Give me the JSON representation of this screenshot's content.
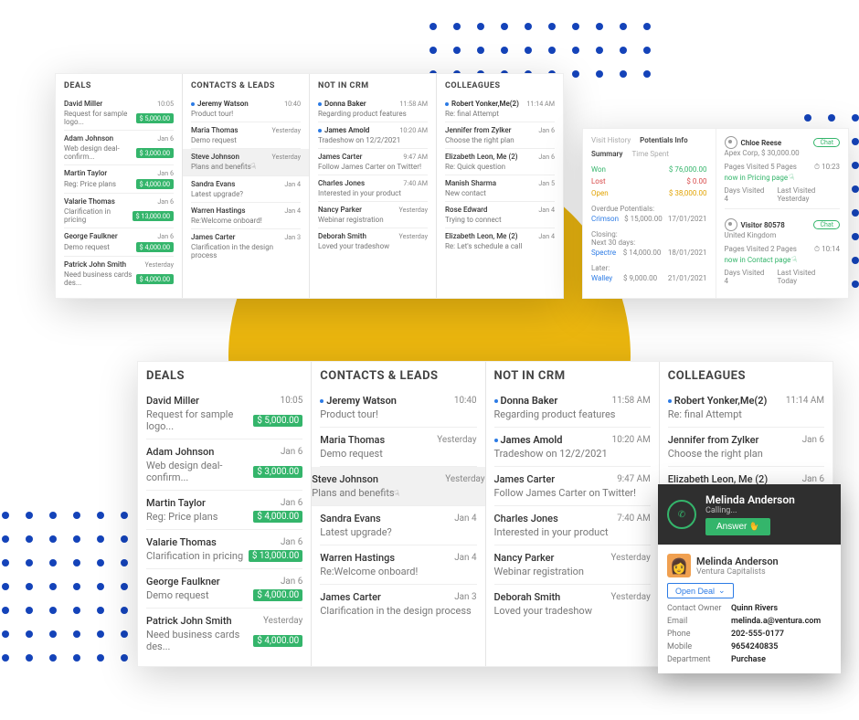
{
  "columns": [
    "DEALS",
    "CONTACTS & LEADS",
    "NOT IN CRM",
    "COLLEAGUES"
  ],
  "small": {
    "deals": [
      {
        "name": "David Miller",
        "time": "10:05",
        "sub": "Request for sample logo...",
        "badge": "$ 5,000.00"
      },
      {
        "name": "Adam Johnson",
        "time": "Jan 6",
        "sub": "Web design deal-confirm...",
        "badge": "$ 3,000.00"
      },
      {
        "name": "Martin Taylor",
        "time": "Jan 6",
        "sub": "Reg: Price plans",
        "badge": "$ 4,000.00"
      },
      {
        "name": "Valarie Thomas",
        "time": "Jan 6",
        "sub": "Clarification in pricing",
        "badge": "$ 13,000.00"
      },
      {
        "name": "George Faulkner",
        "time": "Jan 6",
        "sub": "Demo request",
        "badge": "$ 4,000.00"
      },
      {
        "name": "Patrick John Smith",
        "time": "Yesterday",
        "sub": "Need business cards des...",
        "badge": "$ 4,000.00"
      }
    ],
    "contacts": [
      {
        "name": "Jeremy Watson",
        "time": "10:40",
        "sub": "Product tour!",
        "dot": true
      },
      {
        "name": "Maria Thomas",
        "time": "Yesterday",
        "sub": "Demo request"
      },
      {
        "name": "Steve Johnson",
        "time": "Yesterday",
        "sub": "Plans and benefits",
        "sel": true,
        "cursor": true
      },
      {
        "name": "Sandra Evans",
        "time": "Jan 4",
        "sub": "Latest upgrade?"
      },
      {
        "name": "Warren Hastings",
        "time": "Jan 4",
        "sub": "Re:Welcome onboard!"
      },
      {
        "name": "James Carter",
        "time": "Jan 3",
        "sub": "Clarification in the design process"
      }
    ],
    "notcrm": [
      {
        "name": "Donna Baker",
        "time": "11:58 AM",
        "sub": "Regarding product features",
        "dot": true
      },
      {
        "name": "James Amold",
        "time": "10:20 AM",
        "sub": "Tradeshow on 12/2/2021",
        "dot": true
      },
      {
        "name": "James Carter",
        "time": "9:47 AM",
        "sub": "Follow James Carter on Twitter!"
      },
      {
        "name": "Charles Jones",
        "time": "7:40 AM",
        "sub": "Interested in your product"
      },
      {
        "name": "Nancy Parker",
        "time": "Yesterday",
        "sub": "Webinar registration"
      },
      {
        "name": "Deborah Smith",
        "time": "Yesterday",
        "sub": "Loved your tradeshow"
      }
    ],
    "colleagues": [
      {
        "name": "Robert Yonker,Me(2)",
        "time": "11:14 AM",
        "sub": "Re: final Attempt",
        "dot": true
      },
      {
        "name": "Jennifer from Zylker",
        "time": "Jan 6",
        "sub": "Choose the right plan"
      },
      {
        "name": "Elizabeth Leon, Me (2)",
        "time": "Jan 6",
        "sub": "Re: Quick question"
      },
      {
        "name": "Manish Sharma",
        "time": "Jan 5",
        "sub": "New contact"
      },
      {
        "name": "Rose Edward",
        "time": "Jan 4",
        "sub": "Trying to connect"
      },
      {
        "name": "Elizabeth Leon, Me (2)",
        "time": "Jan 4",
        "sub": "Re: Let's schedule a call"
      }
    ]
  },
  "analytics": {
    "tabs": [
      "Visit History",
      "Potentials Info"
    ],
    "subtabs": [
      "Summary",
      "Time Spent"
    ],
    "summary": [
      {
        "label": "Won",
        "value": "$ 76,000.00",
        "cls": "win"
      },
      {
        "label": "Lost",
        "value": "$ 0.00",
        "cls": "lost"
      },
      {
        "label": "Open",
        "value": "$ 38,000.00",
        "cls": "open"
      }
    ],
    "overdue_title": "Overdue Potentials:",
    "overdue": [
      {
        "name": "Crimson",
        "amt": "$ 15,000.00",
        "date": "17/01/2021"
      }
    ],
    "closing_title": "Closing:",
    "closing_sub": "Next 30 days:",
    "closing": [
      {
        "name": "Spectre",
        "amt": "$ 14,000.00",
        "date": "18/01/2021"
      }
    ],
    "later_title": "Later:",
    "later": [
      {
        "name": "Walley",
        "amt": "$ 9,000.00",
        "date": "21/01/2021"
      }
    ],
    "visitors": [
      {
        "name": "Chloe Reese",
        "org": "Apex Corp, $ 30,000.00",
        "pages": "Pages Visited 5 Pages",
        "time": "10:23",
        "loc": "now in Pricing page",
        "days": "4",
        "last": "Yesterday"
      },
      {
        "name": "Visitor 80578",
        "org": "United Kingdom",
        "pages": "Pages Visited 2 Pages",
        "time": "10:14",
        "loc": "now in Contact page",
        "days": "4",
        "last": "Today"
      }
    ],
    "days_label": "Days Visited",
    "last_label": "Last Visited",
    "chat": "Chat"
  },
  "call": {
    "name": "Melinda Anderson",
    "status": "Calling...",
    "answer": "Answer",
    "person": "Melinda Anderson",
    "company": "Ventura Capitalists",
    "opendeal": "Open Deal",
    "fields": [
      {
        "k": "Contact Owner",
        "v": "Quinn Rivers"
      },
      {
        "k": "Email",
        "v": "melinda.a@ventura.com",
        "blue": true
      },
      {
        "k": "Phone",
        "v": "202-555-0177"
      },
      {
        "k": "Mobile",
        "v": "9654240835"
      },
      {
        "k": "Department",
        "v": "Purchase"
      }
    ]
  }
}
